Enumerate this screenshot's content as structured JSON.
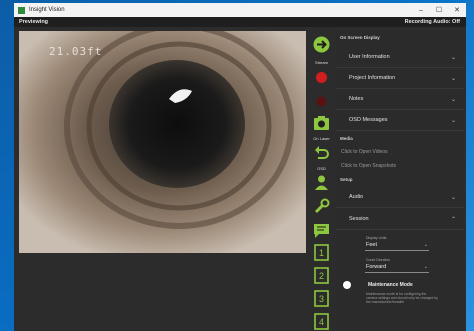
{
  "window": {
    "title": "Insight Vision",
    "minimize": "–",
    "maximize": "☐",
    "close": "✕"
  },
  "status": {
    "left": "Previewing",
    "right": "Recording Audio: Off"
  },
  "video": {
    "overlay_text": "21.03ft"
  },
  "toolbar": {
    "labels": {
      "stream": "Stream",
      "snapshot": "On Laser",
      "osd": "OSD"
    },
    "numbered": [
      "1",
      "2",
      "3",
      "4"
    ],
    "accent_color": "#8dc63f"
  },
  "panel": {
    "onscreen_display_title": "On Screen Display",
    "items": [
      {
        "label": "User Information"
      },
      {
        "label": "Project Information"
      },
      {
        "label": "Notes"
      },
      {
        "label": "OSD Messages"
      }
    ],
    "media_title": "Media",
    "media_links": [
      "Click to Open Videos",
      "Click to Open Snapshots"
    ],
    "setup_title": "Setup",
    "setup_items": [
      {
        "label": "Audio"
      },
      {
        "label": "Session"
      }
    ],
    "session": {
      "display_units_label": "Display Units",
      "display_units_value": "Feet",
      "count_direction_label": "Count Direction",
      "count_direction_value": "Forward"
    },
    "maintenance": {
      "label": "Maintenance Mode",
      "note": "Maintenance mode is for configuring the camera settings and should only be changed by the manufacturer/installer"
    }
  }
}
